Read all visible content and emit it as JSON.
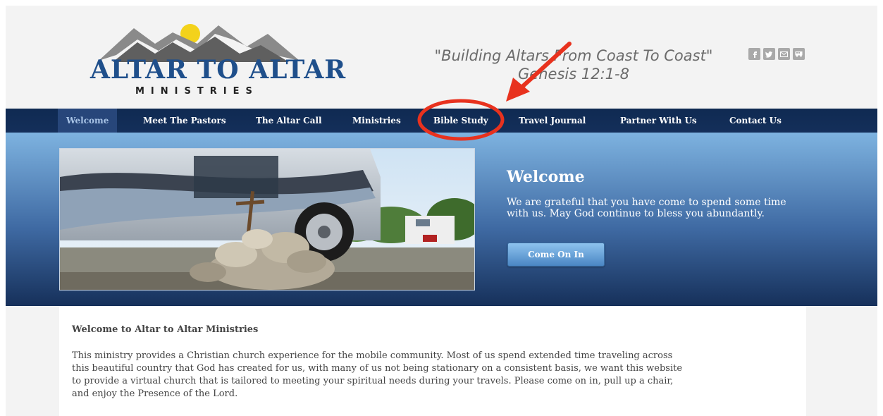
{
  "header": {
    "logo_title": "ALTAR TO ALTAR",
    "logo_subtitle": "MINISTRIES",
    "tagline_line1": "\"Building Altars From Coast To Coast\"",
    "tagline_line2": "Genesis 12:1-8",
    "social_icons": [
      "facebook-icon",
      "twitter-icon",
      "email-icon",
      "rv-icon"
    ]
  },
  "nav": {
    "items": [
      {
        "label": "Welcome",
        "active": true
      },
      {
        "label": "Meet The Pastors"
      },
      {
        "label": "The Altar Call"
      },
      {
        "label": "Ministries"
      },
      {
        "label": "Bible Study"
      },
      {
        "label": "Travel Journal"
      },
      {
        "label": "Partner With Us"
      },
      {
        "label": "Contact Us"
      }
    ]
  },
  "hero": {
    "title": "Welcome",
    "text": "We are grateful that you have come to spend some time with us.  May God continue to bless you abundantly.",
    "button_label": "Come On In"
  },
  "content": {
    "title": "Welcome to Altar to Altar Ministries",
    "body_lines": [
      "This ministry provides a Christian church experience for the mobile community.  Most of us spend extended time traveling across",
      "this beautiful country that God has created for us, with many of us not being stationary on a consistent basis, we want this website",
      "to provide a virtual church that is tailored to meeting your spiritual needs during your travels. Please come on in, pull up a chair,",
      "and enjoy the Presence of the Lord."
    ]
  },
  "colors": {
    "nav_bg": "#142f5a",
    "logo_blue": "#1f4f8b",
    "annotation_red": "#e8321e"
  }
}
